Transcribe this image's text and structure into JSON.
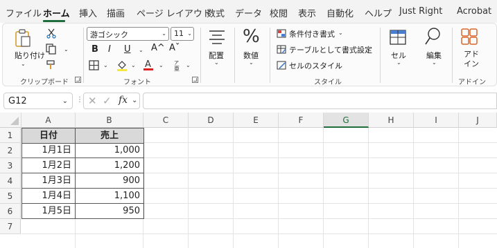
{
  "menu": {
    "tabs": [
      "ファイル",
      "ホーム",
      "挿入",
      "描画",
      "ページ レイアウト",
      "数式",
      "データ",
      "校閲",
      "表示",
      "自動化",
      "ヘルプ",
      "Just Right",
      "Acrobat"
    ],
    "active": "ホーム"
  },
  "ribbon": {
    "clipboard": {
      "paste": "貼り付け",
      "label": "クリップボード"
    },
    "font": {
      "name": "游ゴシック",
      "size": "11",
      "bold": "B",
      "italic": "I",
      "underline": "U",
      "grow": "A^",
      "shrink": "Aˇ",
      "label": "フォント"
    },
    "alignment": {
      "label": "配置"
    },
    "number": {
      "label": "数値",
      "glyph": "%"
    },
    "styles": {
      "conditional": "条件付き書式",
      "table": "テーブルとして書式設定",
      "cell_style": "セルのスタイル",
      "label": "スタイル"
    },
    "cells": {
      "label": "セル"
    },
    "editing": {
      "label": "編集"
    },
    "addin": {
      "button": "アド\nイン",
      "label": "アドイン"
    }
  },
  "formula_bar": {
    "name_box": "G12",
    "fx": "fx",
    "value": ""
  },
  "grid": {
    "columns": [
      "A",
      "B",
      "C",
      "D",
      "E",
      "F",
      "G",
      "H",
      "I",
      "J"
    ],
    "rows": [
      "1",
      "2",
      "3",
      "4",
      "5",
      "6",
      "7"
    ],
    "selected_column": "G",
    "table": {
      "headers": [
        "日付",
        "売上"
      ],
      "rows": [
        [
          "1月1日",
          "1,000"
        ],
        [
          "1月2日",
          "1,200"
        ],
        [
          "1月3日",
          "900"
        ],
        [
          "1月4日",
          "1,100"
        ],
        [
          "1月5日",
          "950"
        ]
      ]
    }
  },
  "colors": {
    "accent": "#1e6b3c",
    "header_fill": "#d9d9d9"
  }
}
